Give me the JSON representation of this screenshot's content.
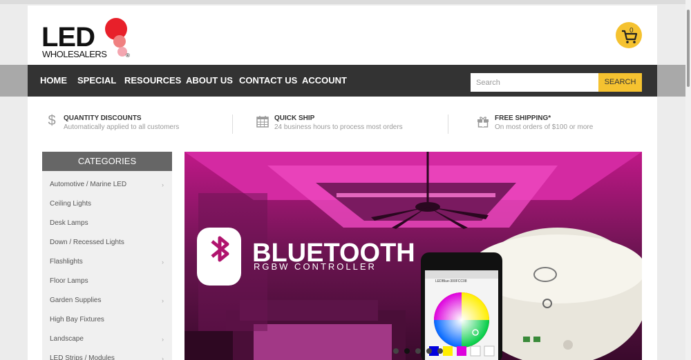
{
  "brand": {
    "logo_main": "LED",
    "logo_sub": "WHOLESALERS",
    "logo_mark": "®"
  },
  "cart": {
    "count": "0"
  },
  "nav": {
    "items": [
      "HOME",
      "SPECIAL",
      "RESOURCES",
      "ABOUT US",
      "CONTACT US",
      "ACCOUNT"
    ]
  },
  "search": {
    "placeholder": "Search",
    "button_label": "SEARCH"
  },
  "features": [
    {
      "icon": "dollar-icon",
      "title": "QUANTITY DISCOUNTS",
      "desc": "Automatically applied to all customers"
    },
    {
      "icon": "calendar-icon",
      "title": "QUICK SHIP",
      "desc": "24 business hours to process most orders"
    },
    {
      "icon": "gift-icon",
      "title": "FREE SHIPPING*",
      "desc": "On most orders of $100 or more"
    }
  ],
  "categories": {
    "title": "CATEGORIES",
    "items": [
      {
        "label": "Automotive / Marine LED",
        "has_sub": true
      },
      {
        "label": "Ceiling Lights",
        "has_sub": false
      },
      {
        "label": "Desk Lamps",
        "has_sub": false
      },
      {
        "label": "Down / Recessed Lights",
        "has_sub": false
      },
      {
        "label": "Flashlights",
        "has_sub": true
      },
      {
        "label": "Floor Lamps",
        "has_sub": false
      },
      {
        "label": "Garden Supplies",
        "has_sub": true
      },
      {
        "label": "High Bay Fixtures",
        "has_sub": false
      },
      {
        "label": "Landscape",
        "has_sub": true
      },
      {
        "label": "LED Strips / Modules",
        "has_sub": true
      }
    ]
  },
  "banner": {
    "headline": "BLUETOOTH",
    "subline": "RGBW CONTROLLER",
    "phone_app_title": "LEDBlue-300FCC08",
    "slide_count": 5,
    "active_slide": 2
  },
  "colors": {
    "accent": "#f5c230",
    "nav_bg": "#333333",
    "banner_pink": "#e0219a"
  }
}
